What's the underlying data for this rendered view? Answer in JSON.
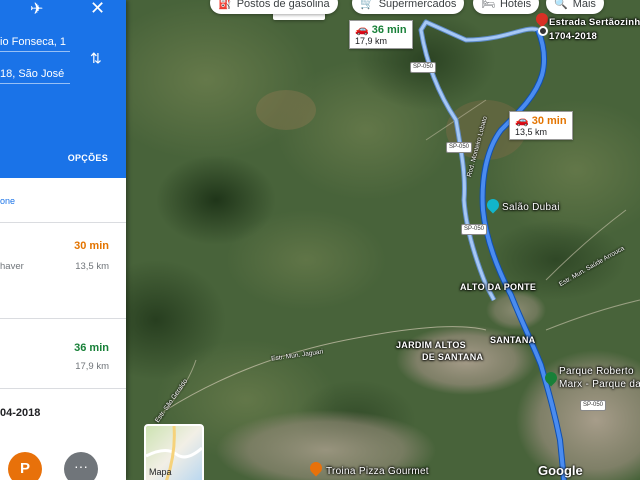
{
  "panel": {
    "origin_text": "io Fonseca, 1",
    "destination_text": "18, São José",
    "options_label": "OPÇÕES",
    "notice_text": "one",
    "routes": [
      {
        "time": "30 min",
        "distance": "13,5 km",
        "note": "haver",
        "time_color": "#e37400"
      },
      {
        "time": "36 min",
        "distance": "17,9 km",
        "note": "",
        "time_color": "#188038"
      }
    ],
    "destination_label": "04-2018",
    "place_button_letter": "P",
    "more_button_label": "···",
    "icons": [
      "flight-icon",
      "close-icon",
      "swap-icon"
    ]
  },
  "map": {
    "chips": [
      {
        "icon": "fuel-icon",
        "label": "Postos de gasolina"
      },
      {
        "icon": "cart-icon",
        "label": "Supermercados"
      },
      {
        "icon": "bed-icon",
        "label": "Hotéis"
      },
      {
        "icon": "search-icon",
        "label": "Mais"
      }
    ],
    "search_partial": "Pt",
    "route_boxes": [
      {
        "time": "36 min",
        "distance": "17,9 km",
        "time_color": "#188038"
      },
      {
        "time": "30 min",
        "distance": "13,5 km",
        "time_color": "#e37400"
      }
    ],
    "destination_marker": {
      "line1": "Estrada Sertãozinh",
      "line2": "1704-2018"
    },
    "places": {
      "salao": "Salão Dubai",
      "alto_da_ponte": "ALTO DA PONTE",
      "jardim_altos_1": "JARDIM ALTOS",
      "jardim_altos_2": "SANTANA",
      "jardim_altos_3": "DE SANTANA",
      "parque_1": "Parque Roberto",
      "parque_2": "Marx - Parque da",
      "pizza": "Troina Pizza Gourmet"
    },
    "road_shields": [
      "SP-050",
      "SP-050",
      "SP-050",
      "SP-050"
    ],
    "road_labels": {
      "municipal": "Estr. Mun. Jaguari",
      "sao_geraldo": "Estr. São Geraldo",
      "bairro": "Estr. Mun. Saúde Arrouca",
      "rodovia": "Rod. Monteiro Lobato"
    },
    "thumbnail_label": "Mapa",
    "logo": "Google",
    "colors": {
      "primary_route": "#1a73e8",
      "alt_route": "#a6c8f5",
      "panel_header": "#1a73e8",
      "destination_pin": "#d93025"
    }
  }
}
